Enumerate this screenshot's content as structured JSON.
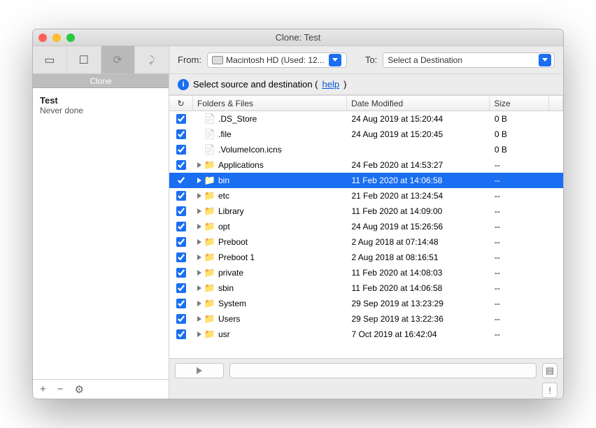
{
  "window": {
    "title": "Clone: Test"
  },
  "sidebar": {
    "section_label": "Clone",
    "tasks": [
      {
        "name": "Test",
        "subtitle": "Never done"
      }
    ],
    "footer": {
      "add": "+",
      "remove": "−"
    }
  },
  "source_dest": {
    "from_label": "From:",
    "source_value": "Macintosh HD (Used: 12...",
    "to_label": "To:",
    "destination_value": "Select a Destination"
  },
  "info": {
    "message_pre": "Select source and destination (",
    "help_label": "help",
    "message_post": ")"
  },
  "columns": {
    "c2": "Folders & Files",
    "c3": "Date Modified",
    "c4": "Size"
  },
  "files": [
    {
      "checked": true,
      "expandable": false,
      "icon": "doc",
      "name": ".DS_Store",
      "date": "24 Aug 2019 at 15:20:44",
      "size": "0 B",
      "selected": false
    },
    {
      "checked": true,
      "expandable": false,
      "icon": "doc",
      "name": ".file",
      "date": "24 Aug 2019 at 15:20:45",
      "size": "0 B",
      "selected": false
    },
    {
      "checked": true,
      "expandable": false,
      "icon": "doc",
      "name": ".VolumeIcon.icns",
      "date": "",
      "size": "0 B",
      "selected": false
    },
    {
      "checked": true,
      "expandable": true,
      "icon": "folder",
      "name": "Applications",
      "date": "24 Feb 2020 at 14:53:27",
      "size": "--",
      "selected": false
    },
    {
      "checked": true,
      "expandable": true,
      "icon": "folder",
      "name": "bin",
      "date": "11 Feb 2020 at 14:06:58",
      "size": "--",
      "selected": true
    },
    {
      "checked": true,
      "expandable": true,
      "icon": "folder",
      "name": "etc",
      "date": "21 Feb 2020 at 13:24:54",
      "size": "--",
      "selected": false
    },
    {
      "checked": true,
      "expandable": true,
      "icon": "folder",
      "name": "Library",
      "date": "11 Feb 2020 at 14:09:00",
      "size": "--",
      "selected": false
    },
    {
      "checked": true,
      "expandable": true,
      "icon": "folder",
      "name": "opt",
      "date": "24 Aug 2019 at 15:26:56",
      "size": "--",
      "selected": false
    },
    {
      "checked": true,
      "expandable": true,
      "icon": "folder",
      "name": "Preboot",
      "date": "2 Aug 2018 at 07:14:48",
      "size": "--",
      "selected": false
    },
    {
      "checked": true,
      "expandable": true,
      "icon": "folder",
      "name": "Preboot 1",
      "date": "2 Aug 2018 at 08:16:51",
      "size": "--",
      "selected": false
    },
    {
      "checked": true,
      "expandable": true,
      "icon": "folder",
      "name": "private",
      "date": "11 Feb 2020 at 14:08:03",
      "size": "--",
      "selected": false
    },
    {
      "checked": true,
      "expandable": true,
      "icon": "folder",
      "name": "sbin",
      "date": "11 Feb 2020 at 14:06:58",
      "size": "--",
      "selected": false
    },
    {
      "checked": true,
      "expandable": true,
      "icon": "folder",
      "name": "System",
      "date": "29 Sep 2019 at 13:23:29",
      "size": "--",
      "selected": false
    },
    {
      "checked": true,
      "expandable": true,
      "icon": "folder",
      "name": "Users",
      "date": "29 Sep 2019 at 13:22:36",
      "size": "--",
      "selected": false
    },
    {
      "checked": true,
      "expandable": true,
      "icon": "folder",
      "name": "usr",
      "date": "7 Oct 2019 at 16:42:04",
      "size": "--",
      "selected": false
    }
  ]
}
